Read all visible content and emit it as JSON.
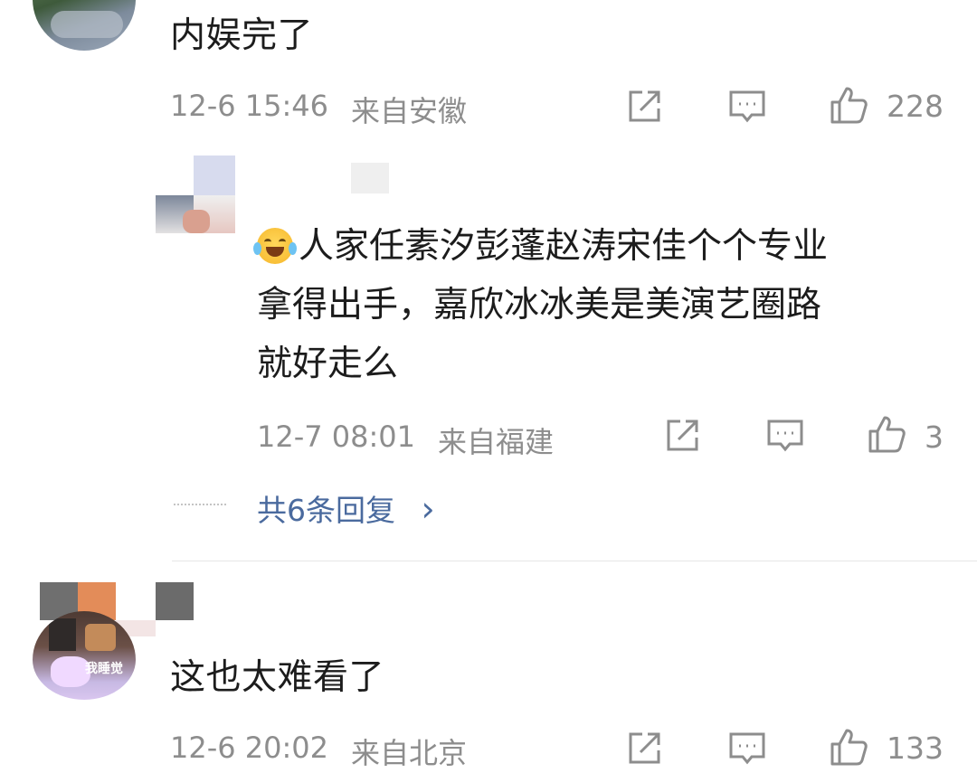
{
  "comments": [
    {
      "text": "内娱完了",
      "time": "12-6 15:46",
      "location": "来自安徽",
      "likes": "228",
      "icons": [
        "share-icon",
        "comment-icon",
        "like-icon"
      ]
    },
    {
      "text": "这也太难看了",
      "avatar_label": "我睡觉",
      "time": "12-6 20:02",
      "location": "来自北京",
      "likes": "133",
      "icons": [
        "share-icon",
        "comment-icon",
        "like-icon"
      ]
    }
  ],
  "reply": {
    "emoji": "crying-laughing-emoji",
    "text": "人家任素汐彭蓬赵涛宋佳个个专业拿得出手，嘉欣冰冰美是美演艺圈路就好走么",
    "line1": "人家任素汐彭蓬赵涛宋佳个个专业",
    "line2": "拿得出手，嘉欣冰冰美是美演艺圈路",
    "line3": "就好走么",
    "time": "12-7 08:01",
    "location": "来自福建",
    "likes": "3"
  },
  "replies_link": {
    "dots": "……",
    "label": "共6条回复",
    "chevron": "›"
  },
  "colors": {
    "meta_gray": "#8d8d8d",
    "link_blue": "#4a6a9e",
    "text": "#1c1c1c"
  }
}
